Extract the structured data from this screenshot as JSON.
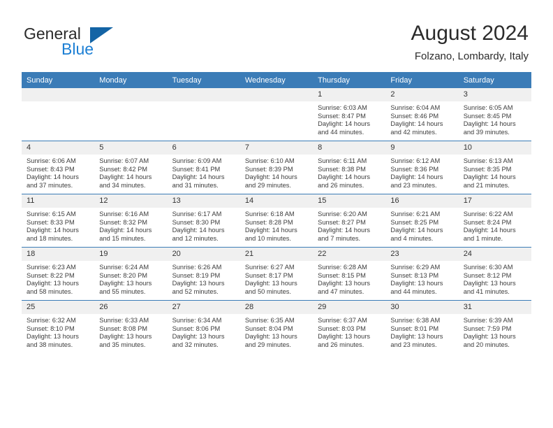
{
  "logo": {
    "primary_text": "General",
    "secondary_text": "Blue",
    "primary_color": "#2b2b2b",
    "secondary_color": "#1c7fd4",
    "triangle_color": "#1464a5"
  },
  "header": {
    "title": "August 2024",
    "subtitle": "Folzano, Lombardy, Italy"
  },
  "theme": {
    "header_row_bg": "#3b7cb7",
    "header_row_text": "#ffffff",
    "daynum_bg": "#f0f0f0",
    "cell_bg": "#ffffff",
    "separator": "#3b7cb7"
  },
  "weekday_headers": [
    "Sunday",
    "Monday",
    "Tuesday",
    "Wednesday",
    "Thursday",
    "Friday",
    "Saturday"
  ],
  "weeks": [
    [
      {
        "day": "",
        "lines": []
      },
      {
        "day": "",
        "lines": []
      },
      {
        "day": "",
        "lines": []
      },
      {
        "day": "",
        "lines": []
      },
      {
        "day": "1",
        "lines": [
          "Sunrise: 6:03 AM",
          "Sunset: 8:47 PM",
          "Daylight: 14 hours",
          "and 44 minutes."
        ]
      },
      {
        "day": "2",
        "lines": [
          "Sunrise: 6:04 AM",
          "Sunset: 8:46 PM",
          "Daylight: 14 hours",
          "and 42 minutes."
        ]
      },
      {
        "day": "3",
        "lines": [
          "Sunrise: 6:05 AM",
          "Sunset: 8:45 PM",
          "Daylight: 14 hours",
          "and 39 minutes."
        ]
      }
    ],
    [
      {
        "day": "4",
        "lines": [
          "Sunrise: 6:06 AM",
          "Sunset: 8:43 PM",
          "Daylight: 14 hours",
          "and 37 minutes."
        ]
      },
      {
        "day": "5",
        "lines": [
          "Sunrise: 6:07 AM",
          "Sunset: 8:42 PM",
          "Daylight: 14 hours",
          "and 34 minutes."
        ]
      },
      {
        "day": "6",
        "lines": [
          "Sunrise: 6:09 AM",
          "Sunset: 8:41 PM",
          "Daylight: 14 hours",
          "and 31 minutes."
        ]
      },
      {
        "day": "7",
        "lines": [
          "Sunrise: 6:10 AM",
          "Sunset: 8:39 PM",
          "Daylight: 14 hours",
          "and 29 minutes."
        ]
      },
      {
        "day": "8",
        "lines": [
          "Sunrise: 6:11 AM",
          "Sunset: 8:38 PM",
          "Daylight: 14 hours",
          "and 26 minutes."
        ]
      },
      {
        "day": "9",
        "lines": [
          "Sunrise: 6:12 AM",
          "Sunset: 8:36 PM",
          "Daylight: 14 hours",
          "and 23 minutes."
        ]
      },
      {
        "day": "10",
        "lines": [
          "Sunrise: 6:13 AM",
          "Sunset: 8:35 PM",
          "Daylight: 14 hours",
          "and 21 minutes."
        ]
      }
    ],
    [
      {
        "day": "11",
        "lines": [
          "Sunrise: 6:15 AM",
          "Sunset: 8:33 PM",
          "Daylight: 14 hours",
          "and 18 minutes."
        ]
      },
      {
        "day": "12",
        "lines": [
          "Sunrise: 6:16 AM",
          "Sunset: 8:32 PM",
          "Daylight: 14 hours",
          "and 15 minutes."
        ]
      },
      {
        "day": "13",
        "lines": [
          "Sunrise: 6:17 AM",
          "Sunset: 8:30 PM",
          "Daylight: 14 hours",
          "and 12 minutes."
        ]
      },
      {
        "day": "14",
        "lines": [
          "Sunrise: 6:18 AM",
          "Sunset: 8:28 PM",
          "Daylight: 14 hours",
          "and 10 minutes."
        ]
      },
      {
        "day": "15",
        "lines": [
          "Sunrise: 6:20 AM",
          "Sunset: 8:27 PM",
          "Daylight: 14 hours",
          "and 7 minutes."
        ]
      },
      {
        "day": "16",
        "lines": [
          "Sunrise: 6:21 AM",
          "Sunset: 8:25 PM",
          "Daylight: 14 hours",
          "and 4 minutes."
        ]
      },
      {
        "day": "17",
        "lines": [
          "Sunrise: 6:22 AM",
          "Sunset: 8:24 PM",
          "Daylight: 14 hours",
          "and 1 minute."
        ]
      }
    ],
    [
      {
        "day": "18",
        "lines": [
          "Sunrise: 6:23 AM",
          "Sunset: 8:22 PM",
          "Daylight: 13 hours",
          "and 58 minutes."
        ]
      },
      {
        "day": "19",
        "lines": [
          "Sunrise: 6:24 AM",
          "Sunset: 8:20 PM",
          "Daylight: 13 hours",
          "and 55 minutes."
        ]
      },
      {
        "day": "20",
        "lines": [
          "Sunrise: 6:26 AM",
          "Sunset: 8:19 PM",
          "Daylight: 13 hours",
          "and 52 minutes."
        ]
      },
      {
        "day": "21",
        "lines": [
          "Sunrise: 6:27 AM",
          "Sunset: 8:17 PM",
          "Daylight: 13 hours",
          "and 50 minutes."
        ]
      },
      {
        "day": "22",
        "lines": [
          "Sunrise: 6:28 AM",
          "Sunset: 8:15 PM",
          "Daylight: 13 hours",
          "and 47 minutes."
        ]
      },
      {
        "day": "23",
        "lines": [
          "Sunrise: 6:29 AM",
          "Sunset: 8:13 PM",
          "Daylight: 13 hours",
          "and 44 minutes."
        ]
      },
      {
        "day": "24",
        "lines": [
          "Sunrise: 6:30 AM",
          "Sunset: 8:12 PM",
          "Daylight: 13 hours",
          "and 41 minutes."
        ]
      }
    ],
    [
      {
        "day": "25",
        "lines": [
          "Sunrise: 6:32 AM",
          "Sunset: 8:10 PM",
          "Daylight: 13 hours",
          "and 38 minutes."
        ]
      },
      {
        "day": "26",
        "lines": [
          "Sunrise: 6:33 AM",
          "Sunset: 8:08 PM",
          "Daylight: 13 hours",
          "and 35 minutes."
        ]
      },
      {
        "day": "27",
        "lines": [
          "Sunrise: 6:34 AM",
          "Sunset: 8:06 PM",
          "Daylight: 13 hours",
          "and 32 minutes."
        ]
      },
      {
        "day": "28",
        "lines": [
          "Sunrise: 6:35 AM",
          "Sunset: 8:04 PM",
          "Daylight: 13 hours",
          "and 29 minutes."
        ]
      },
      {
        "day": "29",
        "lines": [
          "Sunrise: 6:37 AM",
          "Sunset: 8:03 PM",
          "Daylight: 13 hours",
          "and 26 minutes."
        ]
      },
      {
        "day": "30",
        "lines": [
          "Sunrise: 6:38 AM",
          "Sunset: 8:01 PM",
          "Daylight: 13 hours",
          "and 23 minutes."
        ]
      },
      {
        "day": "31",
        "lines": [
          "Sunrise: 6:39 AM",
          "Sunset: 7:59 PM",
          "Daylight: 13 hours",
          "and 20 minutes."
        ]
      }
    ]
  ]
}
